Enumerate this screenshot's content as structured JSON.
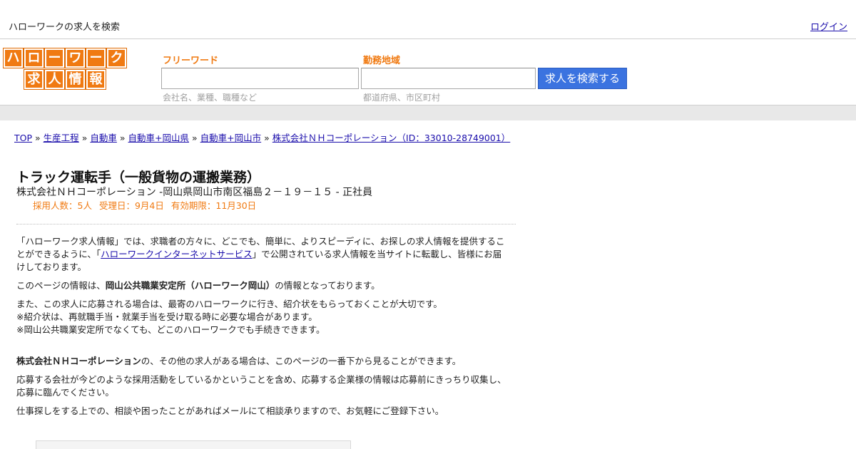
{
  "topbar": {
    "tagline": "ハローワークの求人を検索",
    "login": "ログイン"
  },
  "logo": {
    "row1": [
      "ハ",
      "ロ",
      "ー",
      "ワ",
      "ー",
      "ク"
    ],
    "row2": [
      "求",
      "人",
      "情",
      "報"
    ],
    "color": "#f07a12"
  },
  "search": {
    "keyword_label": "フリーワード",
    "keyword_value": "",
    "keyword_hint": "会社名、業種、職種など",
    "area_label": "勤務地域",
    "area_value": "",
    "area_hint": "都道府県、市区町村",
    "button": "求人を検索する",
    "button_color": "#3b73e0"
  },
  "breadcrumb": {
    "items": [
      "TOP",
      "生産工程",
      "自動車",
      "自動車+岡山県",
      "自動車+岡山市",
      "株式会社ＮＨコーポレーション（ID：33010-28749001）"
    ],
    "separator": "»"
  },
  "job": {
    "title": "トラック運転手（一般貨物の運搬業務）",
    "subtitle": "株式会社ＮＨコーポレーション -岡山県岡山市南区福島２－１９－１５ - 正社員",
    "hires": "採用人数：5人",
    "received": "受理日：9月4日",
    "expires": "有効期限：11月30日"
  },
  "content": {
    "p1_a": "「ハローワーク求人情報」では、求職者の方々に、どこでも、簡単に、よりスピーディに、お探しの求人情報を提供することができるように、「",
    "p1_link": "ハローワークインターネットサービス",
    "p1_b": "」で公開されている求人情報を当サイトに転載し、皆様にお届けしております。",
    "p2_a": "このページの情報は、",
    "p2_bold": "岡山公共職業安定所（ハローワーク岡山）",
    "p2_b": "の情報となっております。",
    "p3_l1": "また、この求人に応募される場合は、最寄のハローワークに行き、紹介状をもらっておくことが大切です。",
    "p3_l2": "※紹介状は、再就職手当・就業手当を受け取る時に必要な場合があります。",
    "p3_l3": "※岡山公共職業安定所でなくても、どこのハローワークでも手続きできます。",
    "p4_bold": "株式会社ＮＨコーポレーション",
    "p4_b": "の、その他の求人がある場合は、このページの一番下から見ることができます。",
    "p5": "応募する会社が今どのような採用活動をしているかということを含め、応募する企業様の情報は応募前にきっちり収集し、応募に臨んでください。",
    "p6": "仕事探しをする上での、相談や困ったことがあればメールにて相談承りますので、お気軽にご登録下さい。"
  }
}
